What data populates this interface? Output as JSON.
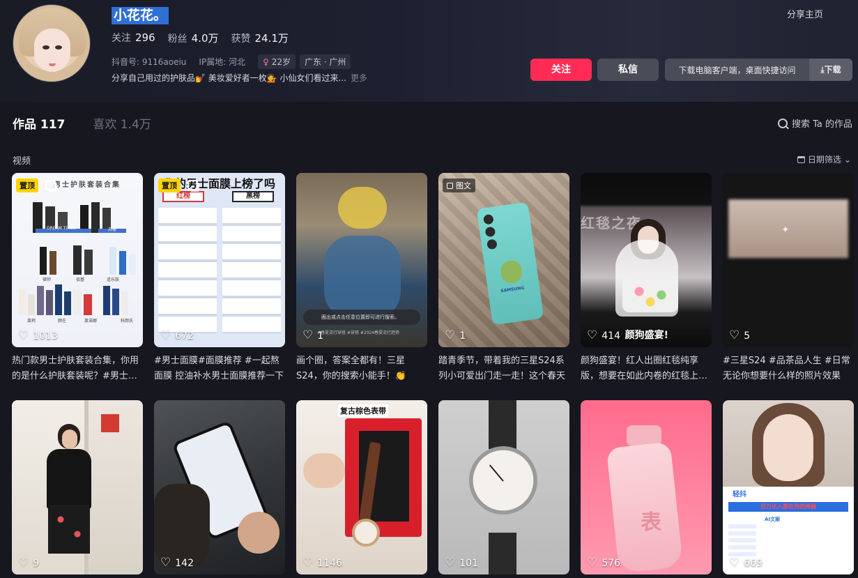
{
  "profile": {
    "nickname": "小花花。",
    "stats": [
      {
        "label": "关注",
        "value": "296"
      },
      {
        "label": "粉丝",
        "value": "4.0万"
      },
      {
        "label": "获赞",
        "value": "24.1万"
      }
    ],
    "douyin_id": "抖音号: 9116aoeiu",
    "ip_location": "IP属地: 河北",
    "age_tag": "22岁",
    "region_tag": "广东 · 广州",
    "bio": "分享自己用过的护肤品💅 美妆爱好者一枚💁 小仙女们看过来...",
    "bio_more": "更多"
  },
  "actions": {
    "share_home": "分享主页",
    "follow": "关注",
    "message": "私信",
    "download_desktop": "下载电脑客户端，桌面快捷访问",
    "download_button": "⤓下载"
  },
  "tabs": {
    "works": "作品 117",
    "likes": "喜欢 1.4万",
    "search_works": "搜索 Ta 的作品"
  },
  "section": {
    "label": "视频",
    "date_filter": "日期筛选"
  },
  "videos": [
    {
      "likes": "1013",
      "pinned": "置顶",
      "desc": "热门款男士护肤套装合集，你用的是什么护肤套装呢？#男士护肤"
    },
    {
      "likes": "672",
      "pinned": "置顶",
      "desc": "#男士面膜#面膜推荐 #一起熬面膜 控油补水男士面膜推荐一下"
    },
    {
      "likes": "1",
      "desc": "画个圈，答案全都有！三星S24，你的搜索小能手！👏"
    },
    {
      "likes": "1",
      "badge": "图文",
      "desc": "踏青季节，带着我的三星S24系列小可爱出门走一走！这个春天"
    },
    {
      "likes": "414",
      "caption": "颜狗盛宴!",
      "desc": "颜狗盛宴！红人出圈红毯纯享版，想要在如此内卷的红毯上出圈"
    },
    {
      "likes": "5",
      "desc": "#三星S24 #品茶品人生 #日常无论你想要什么样的照片效果"
    },
    {
      "likes": "9",
      "desc": ""
    },
    {
      "likes": "142",
      "desc": ""
    },
    {
      "likes": "1146",
      "desc": ""
    },
    {
      "likes": "101",
      "desc": ""
    },
    {
      "likes": "576",
      "desc": ""
    },
    {
      "likes": "669",
      "desc": ""
    }
  ],
  "thumb_text": {
    "t1_title": "男士护肤套装合集",
    "t1_labels": [
      "DREAM TIMES",
      "苏秘",
      "律师",
      "佰基",
      "适乐肤",
      "莱珂",
      "颜在",
      "莱诺娜",
      "科颜氏"
    ],
    "t2_title": "你的男士面膜上榜了吗",
    "t2_red": "红榜",
    "t2_black": "黑榜",
    "t3_prompt": "圈出或点击任意位置即可进行搜索。",
    "t3_tags": "#春夏流行穿搭 #穿搭 #2024春夏流行趋势",
    "t4_brand": "SAMSUNG",
    "t5_sign": "红毯之夜",
    "t9_title": "复古棕色表带",
    "t11_text": "表",
    "t12_app": "轻抖",
    "t12_banner": "百万达人都在用的神器",
    "t12_ai": "AI文案"
  },
  "colors": {
    "accent": "#fe2c55",
    "nickname_highlight": "#2f6fd6",
    "pinned": "#ffd400"
  }
}
